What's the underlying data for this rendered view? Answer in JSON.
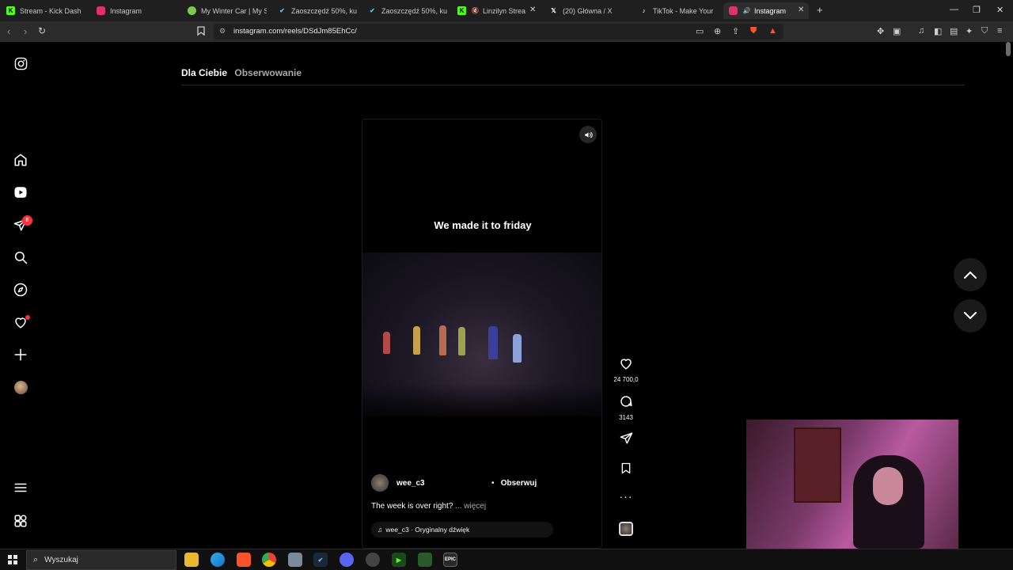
{
  "browser": {
    "tabs": [
      {
        "label": "Stream - Kick Dash",
        "icon": "kick-icon",
        "color": "#53fc18"
      },
      {
        "label": "Instagram",
        "icon": "instagram-icon",
        "color": "#e1306c"
      },
      {
        "label": "My Winter Car | My Su",
        "icon": "game-icon",
        "color": "#7ec850"
      },
      {
        "label": "Zaoszczędź 50%, kupu",
        "icon": "steam-icon",
        "color": "#66c0f4"
      },
      {
        "label": "Zaoszczędź 50%, kupu",
        "icon": "steam-icon",
        "color": "#66c0f4"
      },
      {
        "label": "Linzilyn Stream",
        "icon": "kick-icon",
        "color": "#53fc18"
      },
      {
        "label": "(20) Główna / X",
        "icon": "x-icon",
        "color": "#ffffff"
      },
      {
        "label": "TikTok - Make Your Da",
        "icon": "tiktok-icon",
        "color": "#ffffff"
      },
      {
        "label": "Instagram",
        "icon": "instagram-icon",
        "color": "#e1306c"
      }
    ],
    "url": "instagram.com/reels/DSdJm85EhCc/"
  },
  "instagram": {
    "feed_tabs": {
      "for_you": "Dla Ciebie",
      "following": "Obserwowanie"
    },
    "messages_badge": "8",
    "reel": {
      "overlay_text": "We made it to friday",
      "username": "wee_c3",
      "follow_label": "Obserwuj",
      "description": "The week is over right?",
      "more_label": "... więcej",
      "audio": "wee_c3 · Oryginalny dźwięk"
    },
    "actions": {
      "likes": "24 700,0",
      "comments": "3143"
    }
  },
  "taskbar": {
    "search_placeholder": "Wyszukaj",
    "apps": [
      "file-explorer-icon",
      "edge-icon",
      "brave-icon",
      "chrome-icon",
      "app-icon",
      "steam-icon",
      "discord-icon",
      "app-icon",
      "launcher-icon",
      "app-icon",
      "epic-games-icon"
    ],
    "epic_label": "EPIC"
  }
}
